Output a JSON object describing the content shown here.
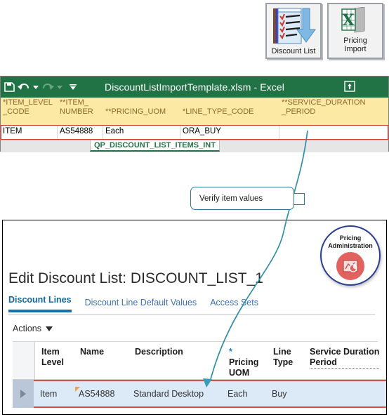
{
  "top_buttons": [
    {
      "label": "Discount List",
      "icon": "discount-list-icon"
    },
    {
      "label": "Pricing\nImport",
      "icon": "excel-import-icon"
    }
  ],
  "excel": {
    "title": "DiscountListImportTemplate.xlsm - Excel",
    "quick_access": [
      "save-icon",
      "undo-icon",
      "redo-icon",
      "customize-qat-icon"
    ],
    "restore_icon": "restore-window-icon",
    "columns": [
      "*ITEM_LEVEL\n_CODE",
      "**ITEM_\nNUMBER",
      "**PRICING_UOM",
      "*LINE_TYPE_CODE",
      "**SERVICE_DURATION\n_PERIOD"
    ],
    "row": [
      "ITEM",
      "AS54888",
      "Each",
      "ORA_BUY",
      ""
    ],
    "sheet_tab": "QP_DISCOUNT_LIST_ITEMS_INT"
  },
  "callout": {
    "text": "Verify item values"
  },
  "app": {
    "badge": {
      "text": "Pricing\nAdministration",
      "icon": "pricing-admin-icon",
      "ring_color": "#2b3f8c",
      "circle_color": "#e2625f"
    },
    "page_title": "Edit Discount List: DISCOUNT_LIST_1",
    "tabs": [
      {
        "label": "Discount Lines",
        "active": true
      },
      {
        "label": "Discount Line Default Values",
        "active": false
      },
      {
        "label": "Access Sets",
        "active": false
      }
    ],
    "toolbar": {
      "actions_label": "Actions",
      "caret_icon": "chevron-down-icon"
    },
    "table": {
      "headers": [
        {
          "text": "Item\nLevel",
          "required": false,
          "dotted": false
        },
        {
          "text": "Name",
          "required": false,
          "dotted": false
        },
        {
          "text": "Description",
          "required": false,
          "dotted": false
        },
        {
          "text": "Pricing\nUOM",
          "required": true,
          "dotted": false
        },
        {
          "text": "Line\nType",
          "required": false,
          "dotted": false
        },
        {
          "text": "Service Duration\nPeriod",
          "required": false,
          "dotted": true
        }
      ],
      "rows": [
        {
          "expand_icon": "chevron-right-icon",
          "item_level": "Item",
          "name": "AS54888",
          "description": "Standard Desktop",
          "pricing_uom": "Each",
          "line_type": "Buy",
          "service_duration_period": ""
        }
      ]
    }
  },
  "accents": {
    "excel_green": "#217346",
    "excel_header_yellow": "#fbe9a4",
    "highlight_red": "#d4514a",
    "connector_teal": "#2f8fa8",
    "tab_blue": "#1a6fad"
  }
}
